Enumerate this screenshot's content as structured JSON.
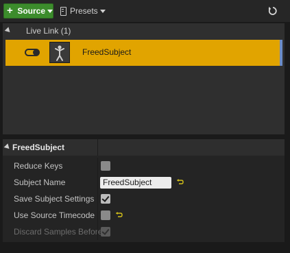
{
  "toolbar": {
    "source_label": "Source",
    "presets_label": "Presets",
    "source_color": "#3c8c2c"
  },
  "icons": {
    "add": "plus-icon",
    "presets": "document-icon",
    "refresh": "refresh-icon",
    "reset": "reset-to-default-icon"
  },
  "subject_list": {
    "group_label": "Live Link (1)",
    "subjects": [
      {
        "name": "FreedSubject",
        "enabled": true,
        "selected": true,
        "highlight_color": "#e1a400"
      }
    ]
  },
  "details": {
    "section_title": "FreedSubject",
    "properties": {
      "reduce_keys": {
        "label": "Reduce Keys",
        "checked": false
      },
      "subject_name": {
        "label": "Subject Name",
        "value": "FreedSubject"
      },
      "save_subject_settings": {
        "label": "Save Subject Settings",
        "checked": true
      },
      "use_source_timecode": {
        "label": "Use Source Timecode",
        "checked": false
      },
      "discard_samples_before": {
        "label": "Discard Samples Before",
        "checked": true,
        "disabled": true
      }
    }
  }
}
